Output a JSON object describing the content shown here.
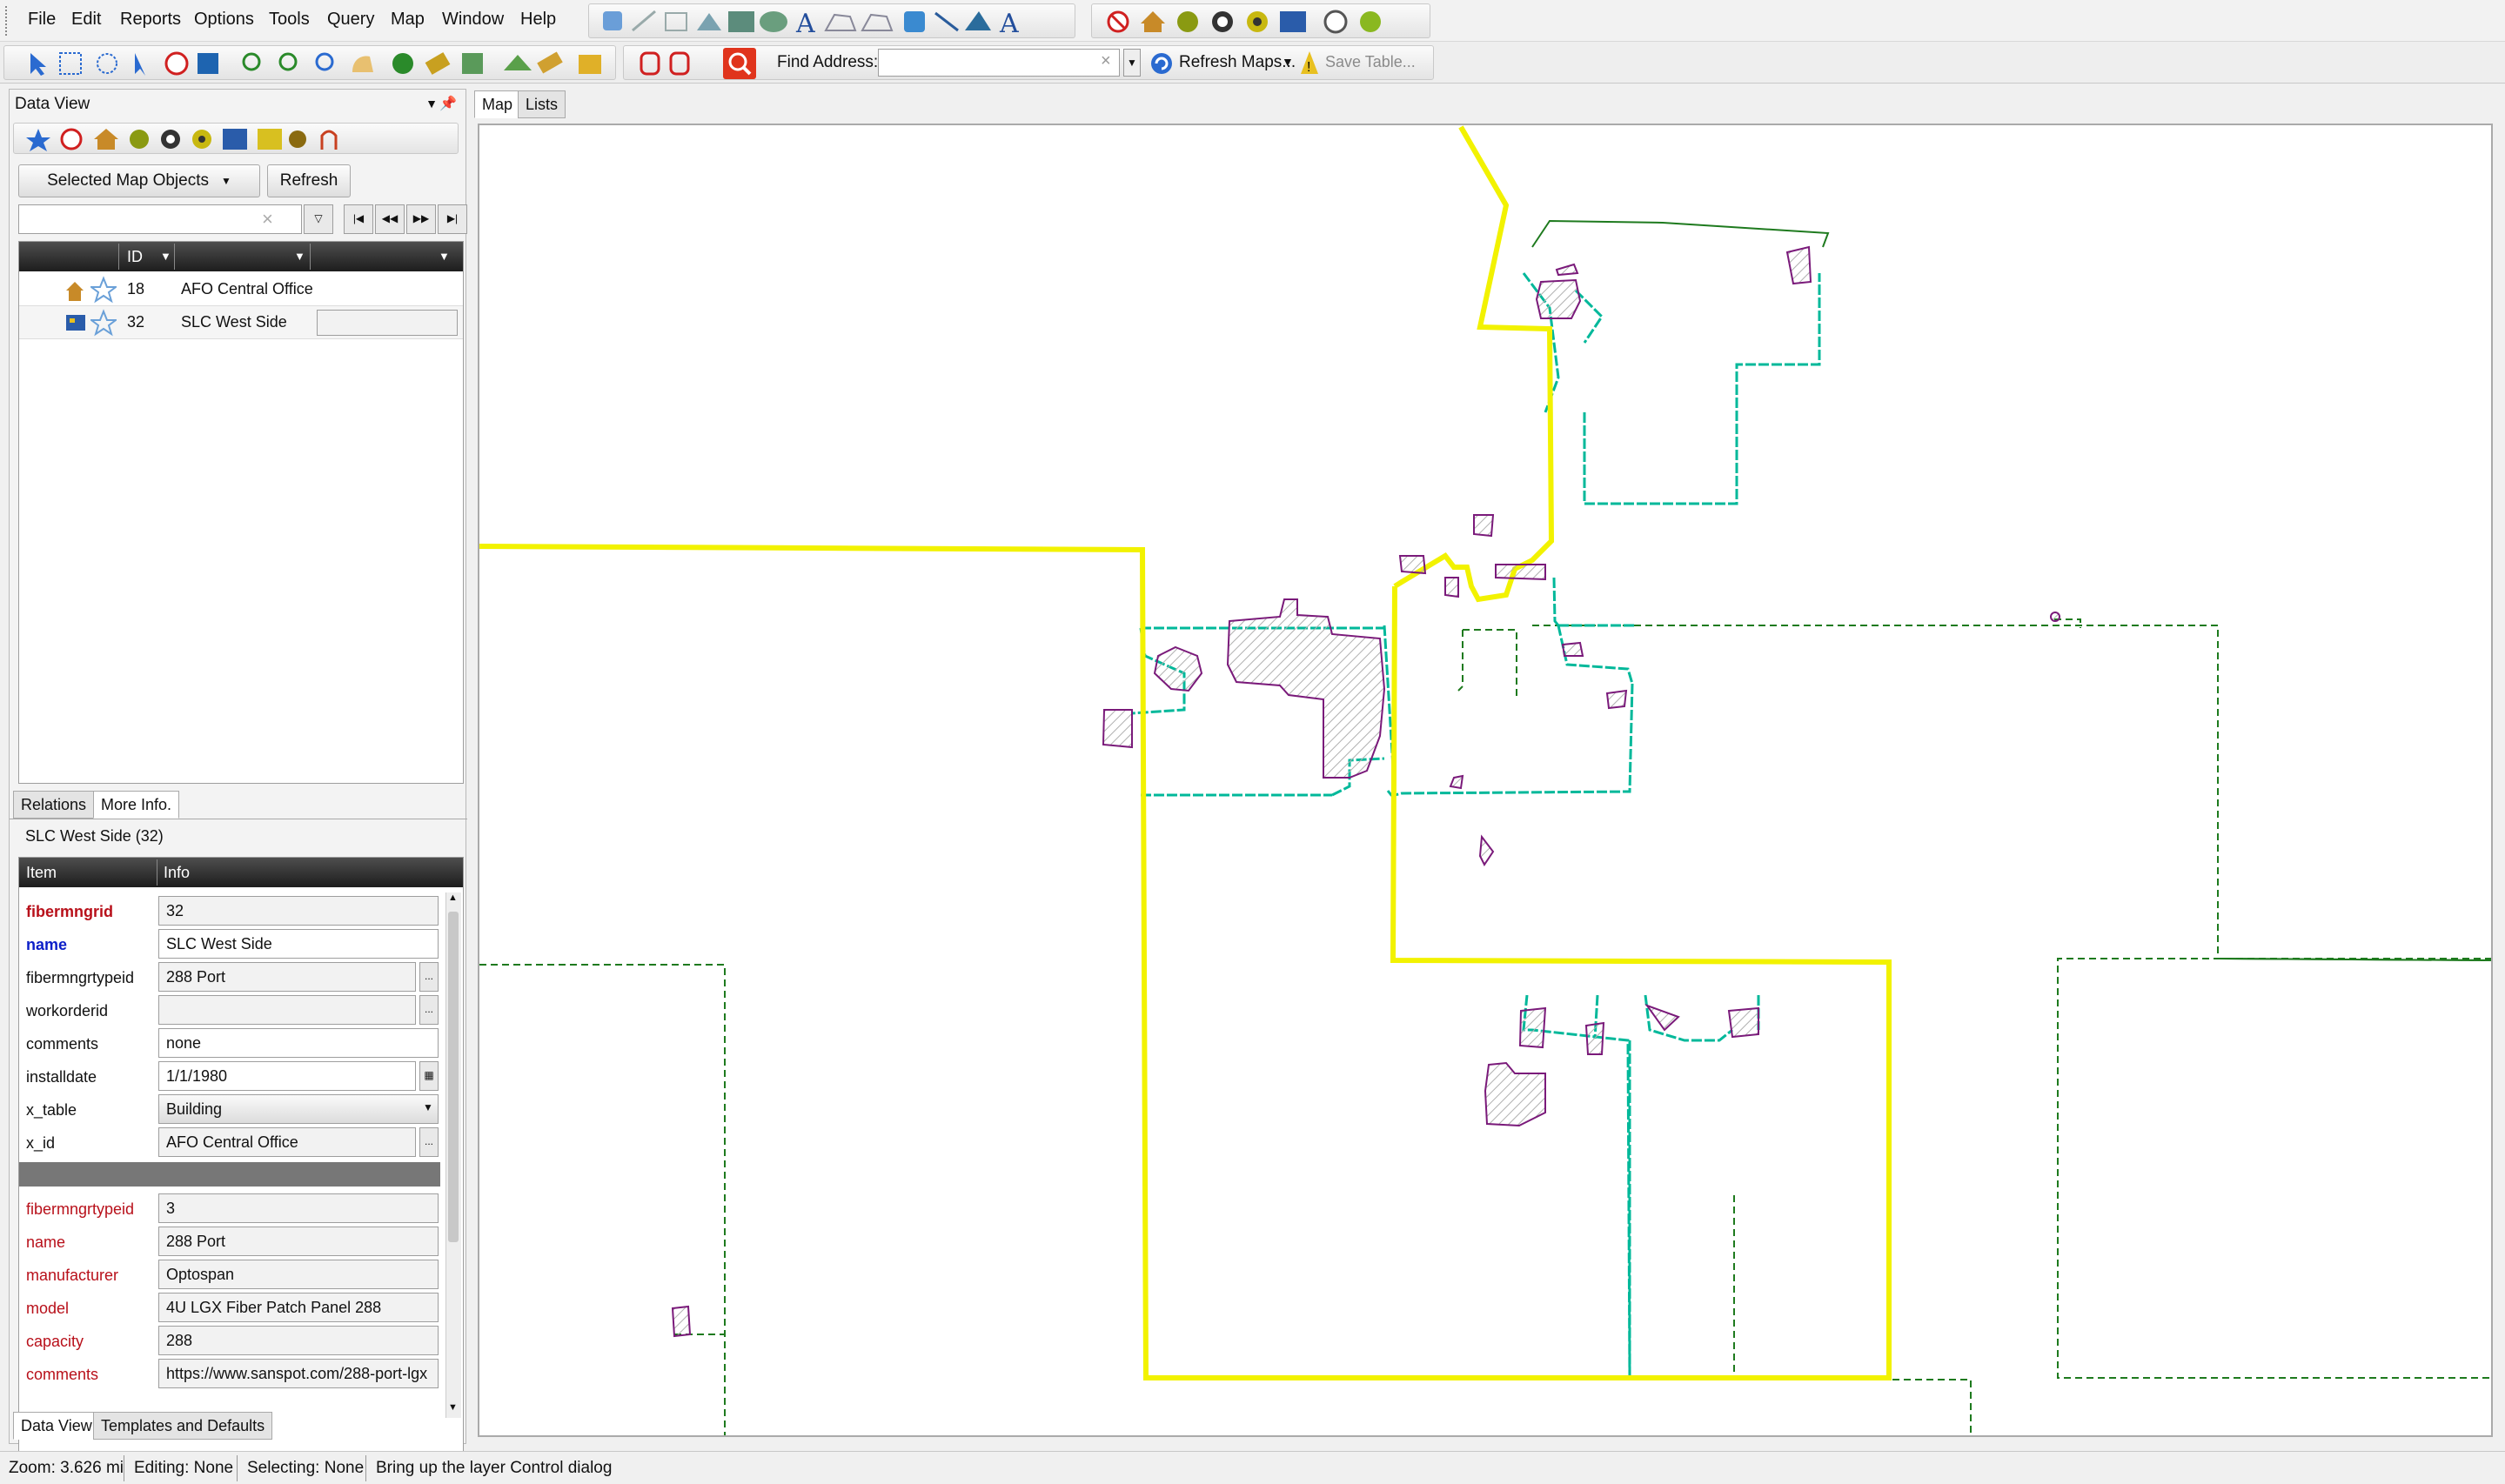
{
  "menu": [
    "File",
    "Edit",
    "Reports",
    "Options",
    "Tools",
    "Query",
    "Map",
    "Window",
    "Help"
  ],
  "toolbar": {
    "find_address_label": "Find Address:",
    "find_address_value": "",
    "refresh_maps_label": "Refresh Maps...",
    "save_table_label": "Save Table..."
  },
  "data_view": {
    "title": "Data View",
    "pin_icon": "pin-icon",
    "selected_objects_label": "Selected Map Objects",
    "refresh_label": "Refresh",
    "filter_value": "",
    "columns": [
      "",
      "ID",
      "",
      ""
    ],
    "rows": [
      {
        "icon": "building-icon",
        "id": "18",
        "name": "AFO Central Office",
        "extra": ""
      },
      {
        "icon": "grid-icon",
        "id": "32",
        "name": "SLC West Side",
        "extra": ""
      }
    ]
  },
  "details": {
    "tabs": [
      "Relations",
      "More Info."
    ],
    "active_tab": "More Info.",
    "subject": "SLC West Side  (32)",
    "headers": [
      "Item",
      "Info"
    ],
    "fields": [
      {
        "label": "fibermngrid",
        "value": "32"
      },
      {
        "label": "name",
        "value": "SLC West Side"
      },
      {
        "label": "fibermngrtypeid",
        "value": "288 Port"
      },
      {
        "label": "workorderid",
        "value": ""
      },
      {
        "label": "comments",
        "value": "none"
      },
      {
        "label": "installdate",
        "value": "1/1/1980"
      },
      {
        "label": "x_table",
        "value": "Building"
      },
      {
        "label": "x_id",
        "value": "AFO Central Office"
      }
    ],
    "related_fields": [
      {
        "label": "fibermngrtypeid",
        "value": "3"
      },
      {
        "label": "name",
        "value": "288 Port"
      },
      {
        "label": "manufacturer",
        "value": "Optospan"
      },
      {
        "label": "model",
        "value": "4U LGX Fiber Patch Panel 288"
      },
      {
        "label": "capacity",
        "value": "288"
      },
      {
        "label": "comments",
        "value": "https://www.sanspot.com/288-port-lgx"
      }
    ]
  },
  "bottom_tabs": [
    "Data View",
    "Templates and Defaults"
  ],
  "map_tabs": [
    "Map",
    "Lists"
  ],
  "status": {
    "zoom": "Zoom: 3.626 mi",
    "editing": "Editing: None",
    "selecting": "Selecting: None",
    "hint": "Bring up the layer Control dialog"
  },
  "colors": {
    "highlight": "#f2f200",
    "fiber": "#00b89a",
    "conduit": "#1e7a1e",
    "building": "#7a1a7a",
    "accent": "#e0341c"
  }
}
